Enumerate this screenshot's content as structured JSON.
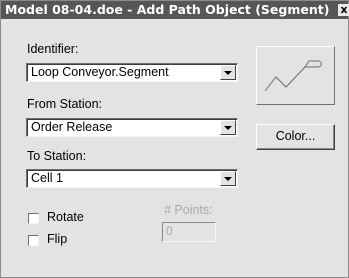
{
  "window": {
    "title": "Model 08-04.doe - Add Path Object (Segment)",
    "close_label": "x"
  },
  "form": {
    "identifier": {
      "label": "Identifier:",
      "value": "Loop Conveyor.Segment"
    },
    "from_station": {
      "label": "From Station:",
      "value": "Order Release"
    },
    "to_station": {
      "label": "To Station:",
      "value": "Cell 1"
    },
    "rotate": {
      "label": "Rotate",
      "checked": false
    },
    "flip": {
      "label": "Flip",
      "checked": false
    },
    "points": {
      "label": "# Points:",
      "value": "0",
      "enabled": false
    }
  },
  "buttons": {
    "color_label": "Color..."
  },
  "icons": {
    "preview": "path-segment-preview-icon",
    "dropdown": "chevron-down-icon"
  }
}
